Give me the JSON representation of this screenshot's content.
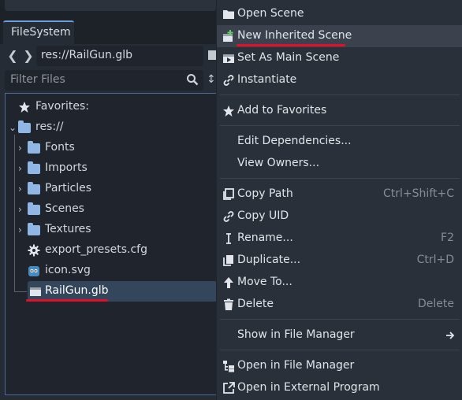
{
  "dock": {
    "tab_label": "FileSystem",
    "path": "res://RailGun.glb",
    "filter_placeholder": "Filter Files",
    "favorites_label": "Favorites:",
    "root_label": "res://",
    "folders": [
      "Fonts",
      "Imports",
      "Particles",
      "Scenes",
      "Textures"
    ],
    "files": [
      "export_presets.cfg",
      "icon.svg"
    ],
    "selected_file": "RailGun.glb"
  },
  "menu": {
    "items": [
      {
        "label": "Open Scene",
        "shortcut": "",
        "icon": "open-scene-icon"
      },
      {
        "label": "New Inherited Scene",
        "shortcut": "",
        "icon": "new-inherited-scene-icon"
      },
      {
        "label": "Set As Main Scene",
        "shortcut": "",
        "icon": "play-scene-icon"
      },
      {
        "label": "Instantiate",
        "shortcut": "",
        "icon": "link-icon"
      },
      {
        "label": "Add to Favorites",
        "shortcut": "",
        "icon": "star-icon"
      },
      {
        "label": "Edit Dependencies...",
        "shortcut": "",
        "icon": ""
      },
      {
        "label": "View Owners...",
        "shortcut": "",
        "icon": ""
      },
      {
        "label": "Copy Path",
        "shortcut": "Ctrl+Shift+C",
        "icon": "copy-icon"
      },
      {
        "label": "Copy UID",
        "shortcut": "",
        "icon": "link-icon"
      },
      {
        "label": "Rename...",
        "shortcut": "F2",
        "icon": "rename-icon"
      },
      {
        "label": "Duplicate...",
        "shortcut": "Ctrl+D",
        "icon": "duplicate-icon"
      },
      {
        "label": "Move To...",
        "shortcut": "",
        "icon": "move-up-icon"
      },
      {
        "label": "Delete",
        "shortcut": "Delete",
        "icon": "trash-icon"
      },
      {
        "label": "Show in File Manager",
        "shortcut": "",
        "icon": ""
      },
      {
        "label": "Open in File Manager",
        "shortcut": "",
        "icon": "filesystem-icon"
      },
      {
        "label": "Open in External Program",
        "shortcut": "",
        "icon": "external-link-icon"
      }
    ],
    "highlighted_index": 1
  },
  "colors": {
    "accent": "#6d9cd8",
    "annotation_red": "#e0102a",
    "folder": "#8fb6e4",
    "selection": "#34465c"
  }
}
